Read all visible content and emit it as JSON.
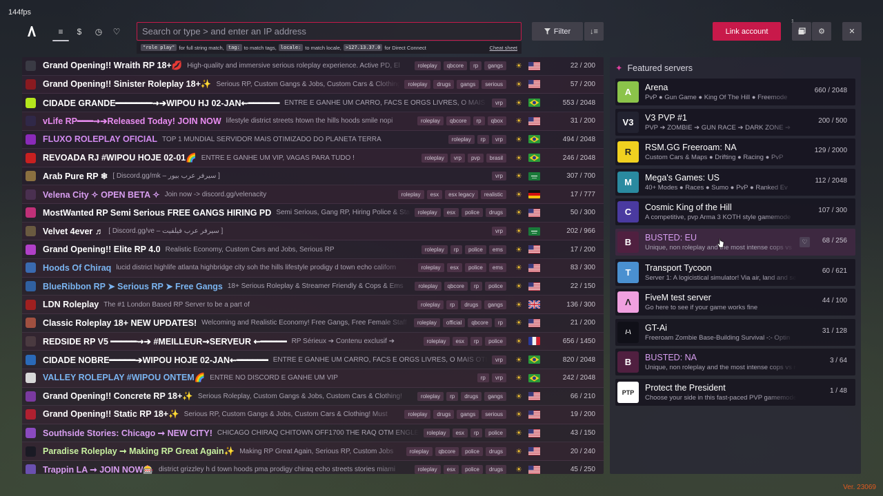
{
  "fps": "144fps",
  "header": {
    "logo_icon": "fivem-logo-icon",
    "tabs": [
      {
        "name": "tab-servers",
        "icon": "list-icon",
        "glyph": "≡",
        "active": true
      },
      {
        "name": "tab-premium",
        "icon": "dollar-icon",
        "glyph": "$",
        "active": false
      },
      {
        "name": "tab-history",
        "icon": "clock-icon",
        "glyph": "◷",
        "active": false
      },
      {
        "name": "tab-favorites",
        "icon": "heart-icon",
        "glyph": "♡",
        "active": false
      }
    ],
    "search_placeholder": "Search or type > and enter an IP address",
    "hints": {
      "code1": "\"role play\"",
      "text1": "for full string match,",
      "code2": "tag:",
      "text2": "to match tags,",
      "code3": "locale:",
      "text3": "to match locale,",
      "code4": ">127.13.37.0",
      "text4": "for Direct Connect",
      "cheat": "Cheat sheet"
    },
    "filter_label": "Filter",
    "link_label": "Link account",
    "notification_count": "1"
  },
  "servers": [
    {
      "name": "Grand Opening!! Wraith RP 18+💋",
      "desc": "High-quality and immersive serious roleplay experience. Active PD, El",
      "tags": [
        "roleplay",
        "qbcore",
        "rp",
        "gangs"
      ],
      "flag": "us",
      "players": "22 / 200",
      "icon_color": "#3a3a44",
      "name_color": "#ffffff"
    },
    {
      "name": "Grand Opening!! Sinister Roleplay 18+✨",
      "desc": "Serious RP, Custom Gangs & Jobs, Custom Cars & Clothing",
      "tags": [
        "roleplay",
        "drugs",
        "gangs",
        "serious"
      ],
      "flag": "us",
      "players": "57 / 200",
      "icon_color": "#8a1a20",
      "name_color": "#ffffff"
    },
    {
      "name": "CIDADE GRANDE━━━━━━━⇝➔WIPOU HJ 02-JAN⇜━━━━━━",
      "desc": "ENTRE E GANHE UM CARRO, FACS E ORGS LIVRES, O MAIS OTIMIZ",
      "tags": [
        "vrp"
      ],
      "flag": "br",
      "players": "553 / 2048",
      "icon_color": "#b5e61d",
      "name_color": "#ffffff"
    },
    {
      "name": "vLife RP━━━⇝➔Released Today! JOIN NOW",
      "desc": "lifestyle district streets htown the hills hoods smile nopi",
      "tags": [
        "roleplay",
        "qbcore",
        "rp",
        "qbox"
      ],
      "flag": "us",
      "players": "31 / 200",
      "icon_color": "#302848",
      "name_color": "#e88cf0"
    },
    {
      "name": "FLUXO ROLEPLAY OFICIAL",
      "desc": "TOP 1 MUNDIAL SERVIDOR MAIS OTIMIZADO DO PLANETA TERRA",
      "tags": [
        "roleplay",
        "rp",
        "vrp"
      ],
      "flag": "br",
      "players": "494 / 2048",
      "icon_color": "#8a2ab8",
      "name_color": "#d28af0"
    },
    {
      "name": "REVOADA RJ #WIPOU HOJE 02-01🌈",
      "desc": "ENTRE E GANHE UM VIP, VAGAS PARA TUDO !",
      "tags": [
        "roleplay",
        "vrp",
        "pvp",
        "brasil"
      ],
      "flag": "br",
      "players": "246 / 2048",
      "icon_color": "#c82020",
      "name_color": "#ffffff"
    },
    {
      "name": "Arab Pure RP ❄",
      "desc": "[ Discord.gg/mk – سيرفر عرب بيور ]",
      "tags": [
        "vrp"
      ],
      "flag": "sa",
      "players": "307 / 700",
      "icon_color": "#8a7040",
      "name_color": "#ffffff"
    },
    {
      "name": "Velena City ✧ OPEN BETA ✧",
      "desc": "Join now -> discord.gg/velenacity",
      "tags": [
        "roleplay",
        "esx",
        "esx legacy",
        "realistic"
      ],
      "flag": "de",
      "players": "17 / 777",
      "icon_color": "#4a3050",
      "name_color": "#d89ef0"
    },
    {
      "name": "MostWanted RP Semi Serious FREE GANGS HIRING PD",
      "desc": "Semi Serious, Gang RP, Hiring Police & Staff",
      "tags": [
        "roleplay",
        "esx",
        "police",
        "drugs"
      ],
      "flag": "us",
      "players": "50 / 300",
      "icon_color": "#c03078",
      "name_color": "#ffffff"
    },
    {
      "name": "Velvet 4ever ♬",
      "desc": "[ Discord.gg/ve – سيرفر عرب فيلفيت ]",
      "tags": [
        "vrp"
      ],
      "flag": "sa",
      "players": "202 / 966",
      "icon_color": "#6a5a40",
      "name_color": "#ffffff"
    },
    {
      "name": "Grand Opening!! Elite RP 4.0",
      "desc": "Realistic Economy, Custom Cars and Jobs, Serious RP",
      "tags": [
        "roleplay",
        "rp",
        "police",
        "ems"
      ],
      "flag": "us",
      "players": "17 / 200",
      "icon_color": "#b040c8",
      "name_color": "#ffffff"
    },
    {
      "name": "Hoods Of Chiraq",
      "desc": "lucid district highlife atlanta highbridge city soh the hills lifestyle prodigy d town echo californ",
      "tags": [
        "roleplay",
        "esx",
        "police",
        "ems"
      ],
      "flag": "us",
      "players": "83 / 300",
      "icon_color": "#3a6ab0",
      "name_color": "#7ab4f0"
    },
    {
      "name": "BlueRibbon RP ➤ Serious RP ➤ Free Gangs",
      "desc": "18+ Serious Roleplay & Streamer Friendly & Cops & Ems",
      "tags": [
        "roleplay",
        "qbcore",
        "rp",
        "police"
      ],
      "flag": "us",
      "players": "22 / 150",
      "icon_color": "#3060a0",
      "name_color": "#7ab4f0"
    },
    {
      "name": "LDN Roleplay",
      "desc": "The #1 London Based RP Server to be a part of",
      "tags": [
        "roleplay",
        "rp",
        "drugs",
        "gangs"
      ],
      "flag": "gb",
      "players": "136 / 300",
      "icon_color": "#a02020",
      "name_color": "#ffffff"
    },
    {
      "name": "Classic Roleplay 18+ NEW UPDATES!",
      "desc": "Welcoming and Realistic Economy! Free Gangs, Free Female Staff",
      "tags": [
        "roleplay",
        "official",
        "qbcore",
        "rp"
      ],
      "flag": "us",
      "players": "21 / 200",
      "icon_color": "#a05040",
      "name_color": "#ffffff"
    },
    {
      "name": "REDSIDE RP V5 ━━━━━⇝➔ #MEILLEUR⇝SERVEUR ⇜━━━━━",
      "desc": "RP Sérieux ➔ Contenu exclusif ➔",
      "tags": [
        "roleplay",
        "esx",
        "rp",
        "police"
      ],
      "flag": "fr",
      "players": "656 / 1450",
      "icon_color": "#4a3a40",
      "name_color": "#ffffff"
    },
    {
      "name": "CIDADE NOBRE━━━━━➔WIPOU HOJE 02-JAN⇜━━━━━━",
      "desc": "ENTRE E GANHE UM CARRO, FACS E ORGS LIVRES, O MAIS OTIMIZADO",
      "tags": [
        "vrp"
      ],
      "flag": "br",
      "players": "820 / 2048",
      "icon_color": "#2a6ab8",
      "name_color": "#ffffff"
    },
    {
      "name": "VALLEY ROLEPLAY #WIPOU ONTEM🌈",
      "desc": "ENTRE NO DISCORD E GANHE UM VIP",
      "tags": [
        "rp",
        "vrp"
      ],
      "flag": "br",
      "players": "242 / 2048",
      "icon_color": "#d8d8d8",
      "name_color": "#7ab4f0"
    },
    {
      "name": "Grand Opening!! Concrete RP 18+✨",
      "desc": "Serious Roleplay, Custom Gangs & Jobs, Custom Cars & Clothing!",
      "tags": [
        "roleplay",
        "rp",
        "drugs",
        "gangs"
      ],
      "flag": "us",
      "players": "66 / 210",
      "icon_color": "#7a3aa0",
      "name_color": "#ffffff"
    },
    {
      "name": "Grand Opening!! Static RP 18+✨",
      "desc": "Serious RP, Custom Gangs & Jobs, Custom Cars & Clothing! Must",
      "tags": [
        "roleplay",
        "drugs",
        "gangs",
        "serious"
      ],
      "flag": "us",
      "players": "19 / 200",
      "icon_color": "#b02030",
      "name_color": "#ffffff"
    },
    {
      "name": "Southside Stories: Chicago ➞ NEW CITY!",
      "desc": "CHICAGO CHIRAQ CHITOWN OFF1700 THE RAQ OTM ENGLEWOOD",
      "tags": [
        "roleplay",
        "esx",
        "rp",
        "police"
      ],
      "flag": "us",
      "players": "43 / 150",
      "icon_color": "#8a4ac0",
      "name_color": "#d89ef0"
    },
    {
      "name": "Paradise Roleplay ➞ Making RP Great Again✨",
      "desc": "Making RP Great Again, Serious RP, Custom Jobs",
      "tags": [
        "roleplay",
        "qbcore",
        "police",
        "drugs"
      ],
      "flag": "us",
      "players": "20 / 240",
      "icon_color": "#1a1a24",
      "name_color": "#c8f0a0"
    },
    {
      "name": "Trappin LA ➞ JOIN NOW🎰",
      "desc": "district grizzley h d town hoods pma prodigy chiraq echo streets stories miami",
      "tags": [
        "roleplay",
        "esx",
        "police",
        "drugs"
      ],
      "flag": "us",
      "players": "45 / 250",
      "icon_color": "#6a50b0",
      "name_color": "#d89ef0"
    }
  ],
  "featured": {
    "title": "Featured servers",
    "icon": "star-icon",
    "items": [
      {
        "name": "Arena",
        "desc": "PvP ● Gun Game ● King Of The Hill ● Freemode",
        "players": "660 / 2048",
        "icon_bg": "#8bc34a",
        "icon_text": "A",
        "name_color": "#ffffff",
        "hover": false
      },
      {
        "name": "V3 PVP #1",
        "desc": "PVP ➔ ZOMBIE ➔ GUN RACE ➔ DARK ZONE ➔",
        "players": "200 / 500",
        "icon_bg": "#222230",
        "icon_text": "V3",
        "name_color": "#ffffff",
        "hover": false
      },
      {
        "name": "RSM.GG Freeroam: NA",
        "desc": "Custom Cars & Maps ● Drifting ● Racing ● PvP",
        "players": "129 / 2000",
        "icon_bg": "#f0d020",
        "icon_text": "R",
        "name_color": "#ffffff",
        "hover": false
      },
      {
        "name": "Mega's Games: US",
        "desc": "40+ Modes ● Races ● Sumo ● PvP ● Ranked Ev",
        "players": "112 / 2048",
        "icon_bg": "#2a8aa0",
        "icon_text": "M",
        "name_color": "#ffffff",
        "hover": false
      },
      {
        "name": "Cosmic King of the Hill",
        "desc": "A competitive, pvp Arma 3 KOTH style gamemode",
        "players": "107 / 300",
        "icon_bg": "#4a3aa0",
        "icon_text": "C",
        "name_color": "#ffffff",
        "hover": false
      },
      {
        "name": "BUSTED: EU",
        "desc": "Unique, non roleplay and the most intense cops vs",
        "players": "68 / 256",
        "icon_bg": "#502040",
        "icon_text": "B",
        "name_color": "#d89ef0",
        "hover": true
      },
      {
        "name": "Transport Tycoon",
        "desc": "Server 1: A logicistical simulator! Via air, land and sea",
        "players": "60 / 621",
        "icon_bg": "#4a90d0",
        "icon_text": "T",
        "name_color": "#ffffff",
        "hover": false
      },
      {
        "name": "FiveM test server",
        "desc": "Go here to see if your game works fine",
        "players": "44 / 100",
        "icon_bg": "#f0a0e0",
        "icon_text": "Λ",
        "name_color": "#ffffff",
        "hover": false
      },
      {
        "name": "GT-Ai",
        "desc": "Freeroam Zombie Base-Building Survival -:- Optin",
        "players": "31 / 128",
        "icon_bg": "#101018",
        "icon_text": "/-\\",
        "name_color": "#ffffff",
        "hover": false
      },
      {
        "name": "BUSTED: NA",
        "desc": "Unique, non roleplay and the most intense cops vs ro",
        "players": "3 / 64",
        "icon_bg": "#502040",
        "icon_text": "B",
        "name_color": "#d89ef0",
        "hover": false
      },
      {
        "name": "Protect the President",
        "desc": "Choose your side in this fast-paced PVP gamemode",
        "players": "1 / 48",
        "icon_bg": "#ffffff",
        "icon_text": "PTP",
        "name_color": "#ffffff",
        "hover": false
      }
    ]
  },
  "version": "Ver. 23069",
  "colors": {
    "accent": "#c8194a",
    "sun": "#f1c232"
  }
}
